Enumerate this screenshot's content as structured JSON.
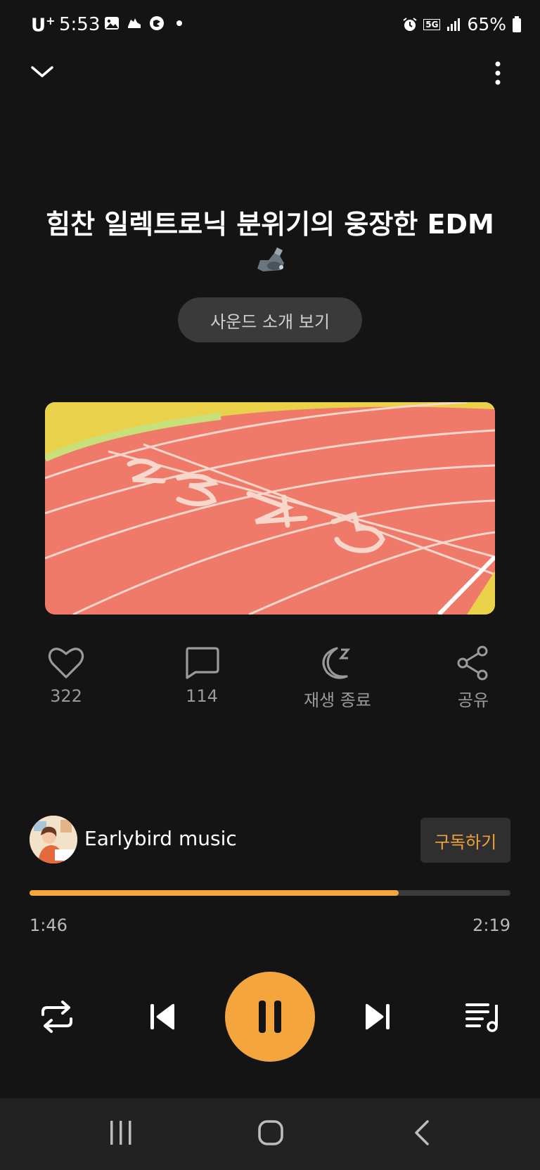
{
  "status_bar": {
    "carrier": "U",
    "carrier_sup": "+",
    "time": "5:53",
    "battery": "65%",
    "network": "5G"
  },
  "player": {
    "title": "힘찬 일렉트로닉 분위기의 웅장한 EDM",
    "title_emoji": "flexed-bicep-mechanical-arm-icon",
    "intro_button": "사운드 소개 보기",
    "artwork": "running-track-lanes-image"
  },
  "actions": {
    "like_count": "322",
    "comment_count": "114",
    "sleep_label": "재생 종료",
    "share_label": "공유"
  },
  "channel": {
    "name": "Earlybird music",
    "subscribe_label": "구독하기"
  },
  "progress": {
    "current": "1:46",
    "duration": "2:19",
    "fraction": 0.768
  },
  "colors": {
    "accent": "#F5A53D",
    "background": "#141414"
  }
}
